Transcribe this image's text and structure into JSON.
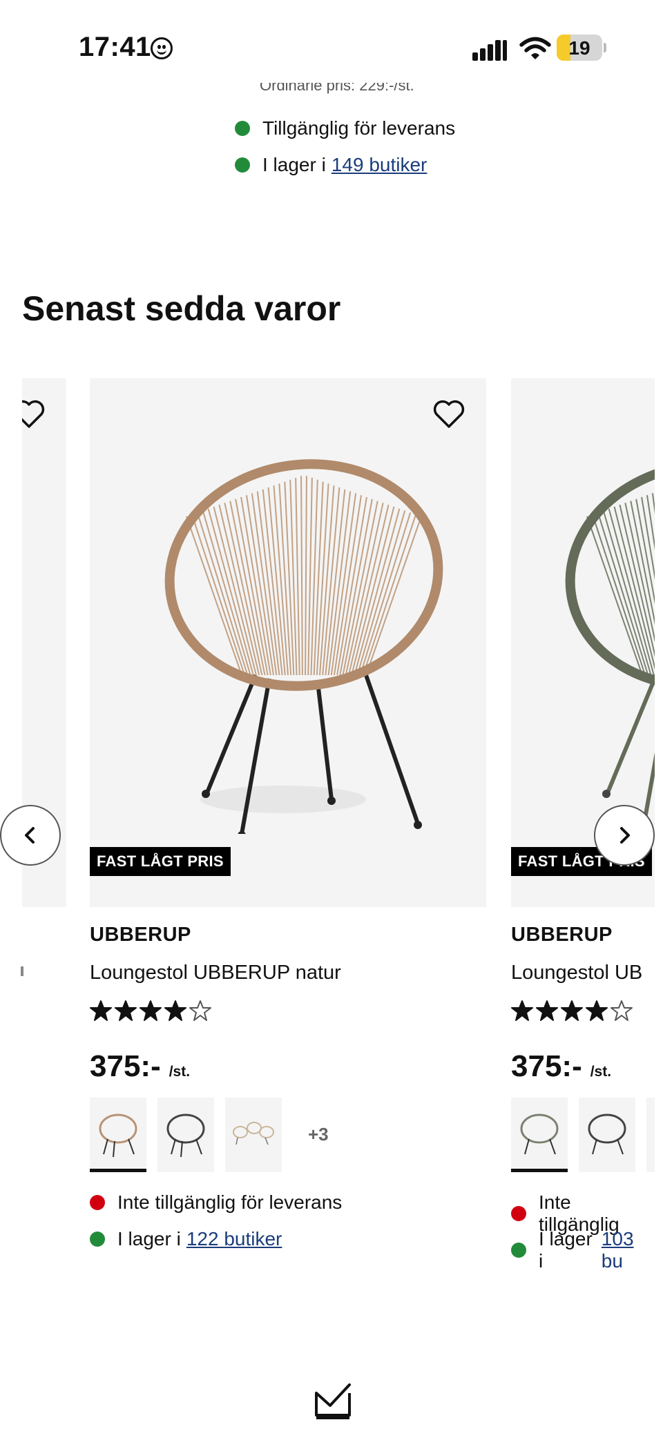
{
  "status_bar": {
    "time": "17:41",
    "battery": "19"
  },
  "top_product": {
    "cut_off_text": "Ordinarie pris: 229:-/st.",
    "delivery": {
      "text": "Tillgänglig för leverans",
      "status_color": "#228b3a"
    },
    "stock": {
      "prefix": "I lager i",
      "link": "149 butiker",
      "status_color": "#228b3a"
    }
  },
  "section": {
    "title": "Senast sedda varor"
  },
  "carousel": {
    "prev_icon": "chevron-left-icon",
    "next_icon": "chevron-right-icon",
    "cards": [
      {
        "badge": "FAST LÅGT PRIS",
        "brand": "UBBERUP",
        "name": "Loungestol UBBERUP natur",
        "rating": 4,
        "rating_max": 5,
        "price": "375:-",
        "unit": "/st.",
        "swatch_more": "+3",
        "delivery": {
          "text": "Inte tillgänglig för leverans",
          "status_color": "#d10010"
        },
        "stock": {
          "prefix": "I lager i",
          "link": "122 butiker",
          "status_color": "#228b3a"
        },
        "chair_color": "#b89274"
      },
      {
        "badge": "FAST LÅGT PRIS",
        "brand": "UBBERUP",
        "name": "Loungestol UB",
        "rating": 4,
        "rating_max": 5,
        "price": "375:-",
        "unit": "/st.",
        "delivery": {
          "text": "Inte tillgänglig",
          "status_color": "#d10010"
        },
        "stock": {
          "prefix": "I lager i",
          "link": "103 bu",
          "status_color": "#228b3a"
        },
        "chair_color": "#6c7360"
      }
    ]
  },
  "bottom_bar": {
    "icon": "checkmark-tray-icon"
  }
}
